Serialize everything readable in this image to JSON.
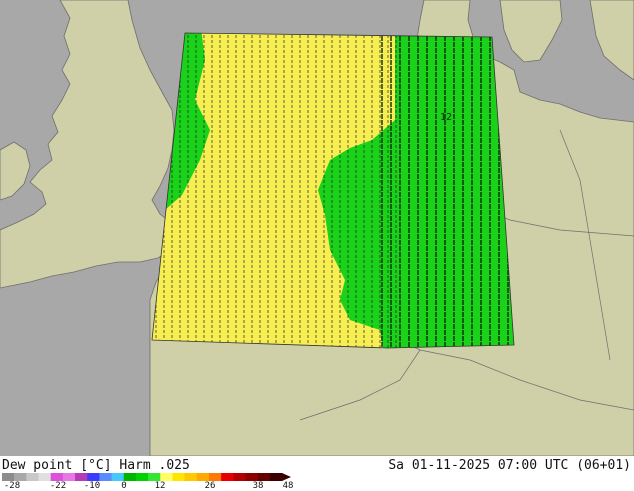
{
  "header": {
    "left_title": "Dew point [°C] Harm .025",
    "right_title": "Sa 01-11-2025 07:00 UTC (06+01)"
  },
  "map": {
    "sea_color": "#a8a8a8",
    "land_color": "#cfcfa8",
    "border_color": "#6e6e6e",
    "field_warm_color": "#f7ee52",
    "field_cool_color": "#19d219",
    "contour_label": "12"
  },
  "legend": {
    "ticks": [
      "-28",
      "-22",
      "-10",
      "0",
      "12",
      "26",
      "38",
      "48"
    ],
    "colors": [
      "#8c8c8c",
      "#a8a8a8",
      "#c8c8c8",
      "#e0e0e0",
      "#dc50dc",
      "#e678e6",
      "#b43cb4",
      "#3c3cff",
      "#5a8cff",
      "#46c8ff",
      "#00b400",
      "#00d200",
      "#32e632",
      "#ffff64",
      "#ffe600",
      "#ffc800",
      "#ffaa00",
      "#ff7800",
      "#e60000",
      "#b40000",
      "#8c0000",
      "#640000",
      "#3c0000"
    ]
  }
}
